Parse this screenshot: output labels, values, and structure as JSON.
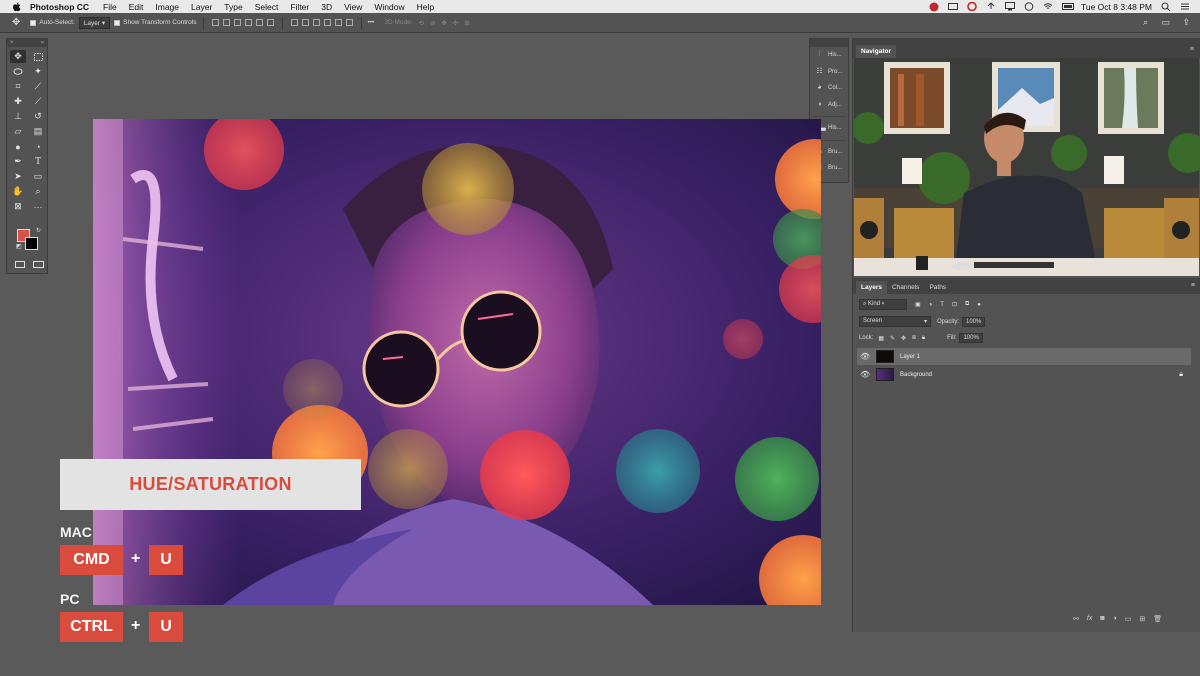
{
  "menubar": {
    "app_name": "Photoshop CC",
    "items": [
      "File",
      "Edit",
      "Image",
      "Layer",
      "Type",
      "Select",
      "Filter",
      "3D",
      "View",
      "Window",
      "Help"
    ],
    "clock": "Tue Oct 8  3:48 PM"
  },
  "options": {
    "auto_select_label": "Auto-Select:",
    "auto_select_value": "Layer",
    "transform_label": "Show Transform Controls",
    "mode_3d": "3D Mode:"
  },
  "mid_panel": {
    "items": [
      "His...",
      "Pro...",
      "Col...",
      "Adj...",
      "His...",
      "Bru...",
      "Bru..."
    ]
  },
  "navigator": {
    "tab_label": "Navigator"
  },
  "layers_panel": {
    "tabs": [
      "Layers",
      "Channels",
      "Paths"
    ],
    "filter_value": "Kind",
    "blend_mode": "Screen",
    "opacity_label": "Opacity:",
    "opacity_value": "100%",
    "lock_label": "Lock:",
    "fill_label": "Fill:",
    "fill_value": "100%",
    "layers": [
      {
        "name": "Layer 1",
        "selected": true
      },
      {
        "name": "Background",
        "selected": false
      }
    ]
  },
  "overlay": {
    "title": "HUE/SATURATION",
    "mac_label": "MAC",
    "mac_keys": [
      "CMD",
      "U"
    ],
    "pc_label": "PC",
    "pc_keys": [
      "CTRL",
      "U"
    ],
    "plus": "+",
    "accent_color": "#d94c3d"
  }
}
